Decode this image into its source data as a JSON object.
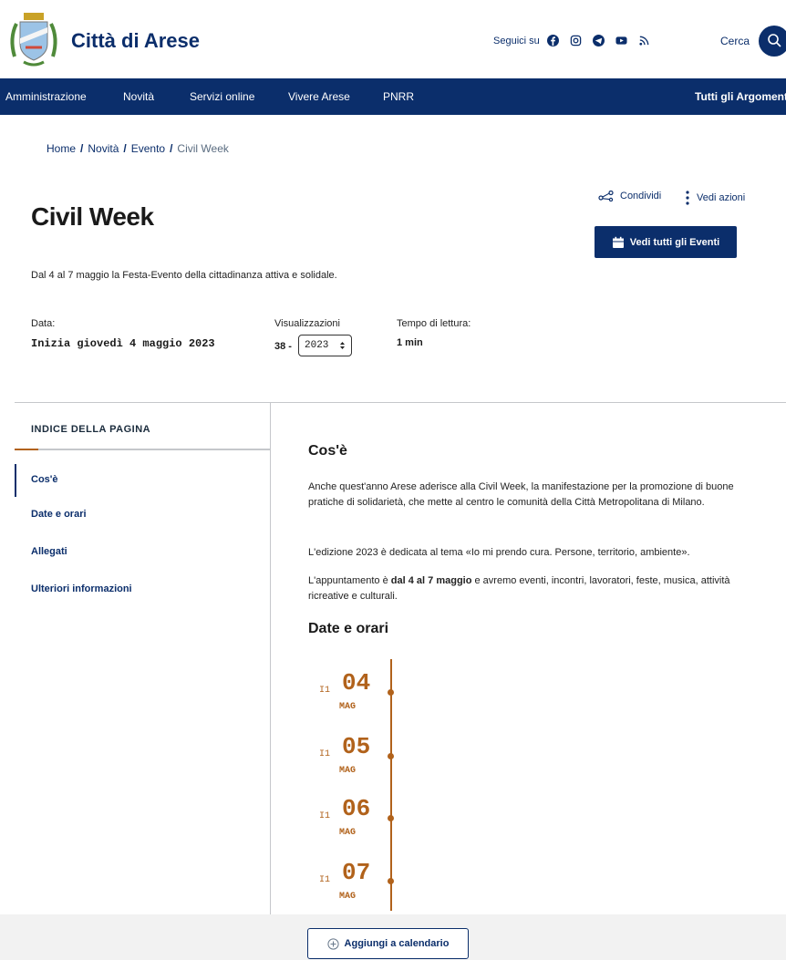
{
  "header": {
    "site_name": "Città di Arese",
    "social_label": "Seguici su",
    "social_icons": [
      "facebook-icon",
      "instagram-icon",
      "telegram-icon",
      "youtube-icon",
      "rss-icon"
    ],
    "search_label": "Cerca"
  },
  "nav": {
    "items": [
      "Amministrazione",
      "Novità",
      "Servizi online",
      "Vivere Arese",
      "PNRR"
    ],
    "right": "Tutti gli Argomenti"
  },
  "breadcrumb": {
    "items": [
      "Home",
      "Novità",
      "Evento"
    ],
    "separator": "/",
    "current": "Civil Week"
  },
  "page": {
    "title": "Civil Week",
    "share_label": "Condividi",
    "actions_label": "Vedi azioni",
    "events_button": "Vedi tutti gli Eventi",
    "subtitle": "Dal 4 al 7 maggio la Festa-Evento della cittadinanza attiva e solidale."
  },
  "meta": {
    "date_label": "Data:",
    "date_value": "Inizia giovedì 4 maggio 2023",
    "views_label": "Visualizzazioni",
    "views_value": "38 -",
    "views_year": "2023",
    "reading_label": "Tempo di lettura:",
    "reading_value": "1 min"
  },
  "toc": {
    "title": "INDICE DELLA PAGINA",
    "items": [
      "Cos'è",
      "Date e orari",
      "Allegati",
      "Ulteriori informazioni"
    ]
  },
  "content": {
    "cos_e_heading": "Cos'è",
    "para1": "Anche quest'anno Arese aderisce alla Civil Week, la manifestazione per la promozione di buone pratiche di solidarietà, che mette al centro le comunità della Città Metropolitana di Milano.",
    "para2": "L'edizione 2023 è dedicata al tema «Io mi prendo cura. Persone, territorio, ambiente».",
    "para3_pre": "L'appuntamento è ",
    "para3_bold": "dal 4 al 7 maggio",
    "para3_post": " e avremo eventi, incontri, lavoratori, feste, musica, attività ricreative e culturali.",
    "dates_heading": "Date e orari"
  },
  "timeline": [
    {
      "weekday": "I1",
      "day": "04",
      "month": "MAG"
    },
    {
      "weekday": "I1",
      "day": "05",
      "month": "MAG"
    },
    {
      "weekday": "I1",
      "day": "06",
      "month": "MAG"
    },
    {
      "weekday": "I1",
      "day": "07",
      "month": "MAG"
    }
  ],
  "calendar_button": "Aggiungi a calendario",
  "colors": {
    "brand": "#0b2e6b",
    "accent": "#b1621b"
  }
}
